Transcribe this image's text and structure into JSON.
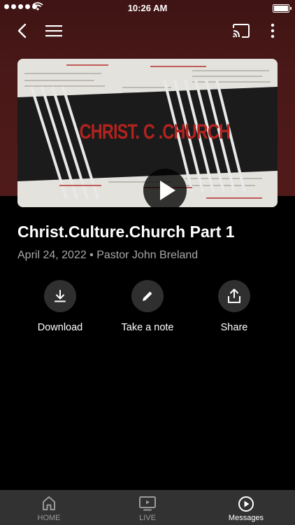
{
  "status_bar": {
    "time": "10:26 AM"
  },
  "toolbar": {
    "back_icon": "chevron-left-icon",
    "menu_icon": "hamburger-menu-icon",
    "cast_icon": "cast-icon",
    "more_icon": "more-vertical-icon"
  },
  "video": {
    "thumbnail_title": "CHRIST. C         .CHURCH",
    "play_icon": "play-icon"
  },
  "message": {
    "title": "Christ.Culture.Church Part 1",
    "meta": "April 24, 2022 • Pastor John Breland"
  },
  "actions": [
    {
      "label": "Download",
      "icon": "download-icon"
    },
    {
      "label": "Take a note",
      "icon": "pencil-icon"
    },
    {
      "label": "Share",
      "icon": "share-icon"
    }
  ],
  "tabs": [
    {
      "label": "HOME",
      "icon": "home-icon",
      "active": false
    },
    {
      "label": "LIVE",
      "icon": "tv-play-icon",
      "active": false
    },
    {
      "label": "Messages",
      "icon": "play-circle-icon",
      "active": true
    }
  ],
  "colors": {
    "header_bg": "#4a1818",
    "background": "#000000",
    "tabbar_bg": "#323232",
    "accent_red": "#b1231f"
  }
}
